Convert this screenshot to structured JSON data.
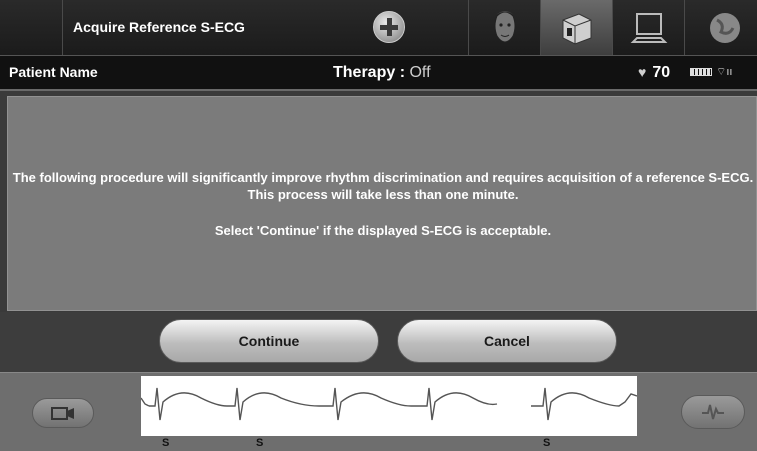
{
  "header": {
    "title": "Acquire Reference S-ECG",
    "tabs": [
      {
        "name": "patient-tab",
        "icon": "patient-face-icon",
        "active": false
      },
      {
        "name": "device-tab",
        "icon": "device-settings-icon",
        "active": true
      },
      {
        "name": "computer-tab",
        "icon": "computer-monitor-icon",
        "active": false
      },
      {
        "name": "clinic-tab",
        "icon": "globe-icon",
        "active": false
      }
    ]
  },
  "status": {
    "patient_label": "Patient Name",
    "therapy_label": "Therapy : ",
    "therapy_value": "Off",
    "heart_rate": "70"
  },
  "message": {
    "paragraph1": "The following procedure will significantly improve rhythm discrimination and requires acquisition of a reference S-ECG. This process will take less than one minute.",
    "paragraph2": "Select 'Continue' if the displayed S-ECG is acceptable."
  },
  "buttons": {
    "continue_label": "Continue",
    "cancel_label": "Cancel"
  },
  "ecg": {
    "markers": [
      "S",
      "S",
      "S"
    ]
  },
  "colors": {
    "header_bg": "#1b1b1b",
    "panel_bg": "#7b7b7b",
    "button_face": "#d8d8d8"
  }
}
